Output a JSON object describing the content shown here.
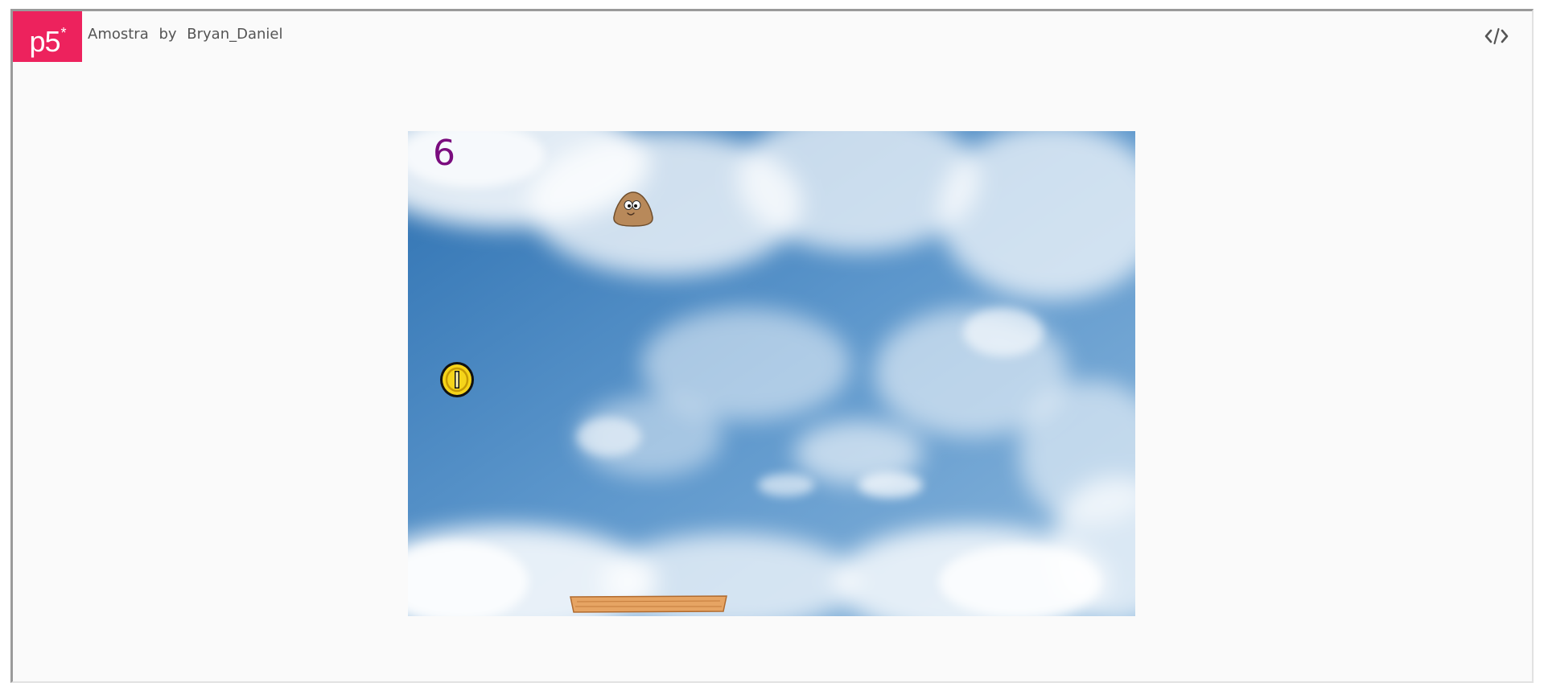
{
  "header": {
    "logo_text": "p5",
    "logo_mark": "*",
    "sketch_name": "Amostra",
    "by_label": "by",
    "author": "Bryan_Daniel",
    "code_icon": "code-icon"
  },
  "colors": {
    "brand": "#ed225d",
    "score": "#7a0c7e",
    "sky": "#4a88c2"
  },
  "game": {
    "score": "6",
    "sprites": [
      "pou-character",
      "gold-coin",
      "wooden-platform"
    ]
  }
}
